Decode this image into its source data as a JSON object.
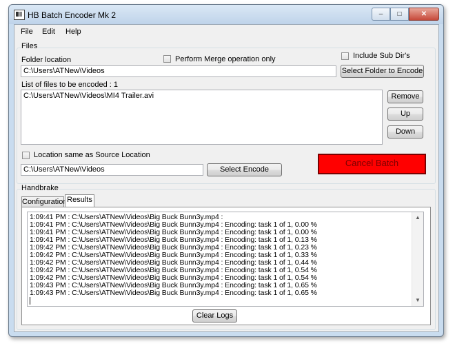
{
  "window": {
    "title": "HB Batch Encoder Mk 2"
  },
  "menu": [
    "File",
    "Edit",
    "Help"
  ],
  "files": {
    "group_label": "Files",
    "folder_label": "Folder location",
    "folder_value": "C:\\Users\\ATNew\\Videos",
    "merge_label": "Perform Merge operation only",
    "merge_checked": false,
    "subdirs_label": "Include Sub Dir's",
    "subdirs_checked": false,
    "select_folder_label": "Select Folder to Encode",
    "list_label": "List of files to be encoded :  1",
    "list_items": [
      "C:\\Users\\ATNew\\Videos\\MI4 Trailer.avi"
    ],
    "remove_label": "Remove",
    "up_label": "Up",
    "down_label": "Down",
    "location_same_label": "Location same as Source Location",
    "location_same_checked": false,
    "output_value": "C:\\Users\\ATNew\\Videos",
    "select_encode_label": "Select Encode",
    "cancel_label": "Cancel Batch"
  },
  "handbrake": {
    "group_label": "Handbrake",
    "tabs": [
      "Configuration",
      "Results"
    ],
    "active_tab": "Results",
    "log_lines": [
      "1:09:41 PM : C:\\Users\\ATNew\\Videos\\Big Buck Bunn3y.mp4 :",
      "1:09:41 PM : C:\\Users\\ATNew\\Videos\\Big Buck Bunn3y.mp4 : Encoding: task 1 of 1, 0.00 %",
      "1:09:41 PM : C:\\Users\\ATNew\\Videos\\Big Buck Bunn3y.mp4 : Encoding: task 1 of 1, 0.00 %",
      "1:09:41 PM : C:\\Users\\ATNew\\Videos\\Big Buck Bunn3y.mp4 : Encoding: task 1 of 1, 0.13 %",
      "1:09:42 PM : C:\\Users\\ATNew\\Videos\\Big Buck Bunn3y.mp4 : Encoding: task 1 of 1, 0.23 %",
      "1:09:42 PM : C:\\Users\\ATNew\\Videos\\Big Buck Bunn3y.mp4 : Encoding: task 1 of 1, 0.33 %",
      "1:09:42 PM : C:\\Users\\ATNew\\Videos\\Big Buck Bunn3y.mp4 : Encoding: task 1 of 1, 0.44 %",
      "1:09:42 PM : C:\\Users\\ATNew\\Videos\\Big Buck Bunn3y.mp4 : Encoding: task 1 of 1, 0.54 %",
      "1:09:42 PM : C:\\Users\\ATNew\\Videos\\Big Buck Bunn3y.mp4 : Encoding: task 1 of 1, 0.54 %",
      "1:09:43 PM : C:\\Users\\ATNew\\Videos\\Big Buck Bunn3y.mp4 : Encoding: task 1 of 1, 0.65 %",
      "1:09:43 PM : C:\\Users\\ATNew\\Videos\\Big Buck Bunn3y.mp4 : Encoding: task 1 of 1, 0.65 %"
    ],
    "clear_logs_label": "Clear Logs"
  },
  "colors": {
    "cancel_bg": "#ff0000",
    "cancel_text": "#7a0000",
    "window_frame": "#c9dcef"
  }
}
